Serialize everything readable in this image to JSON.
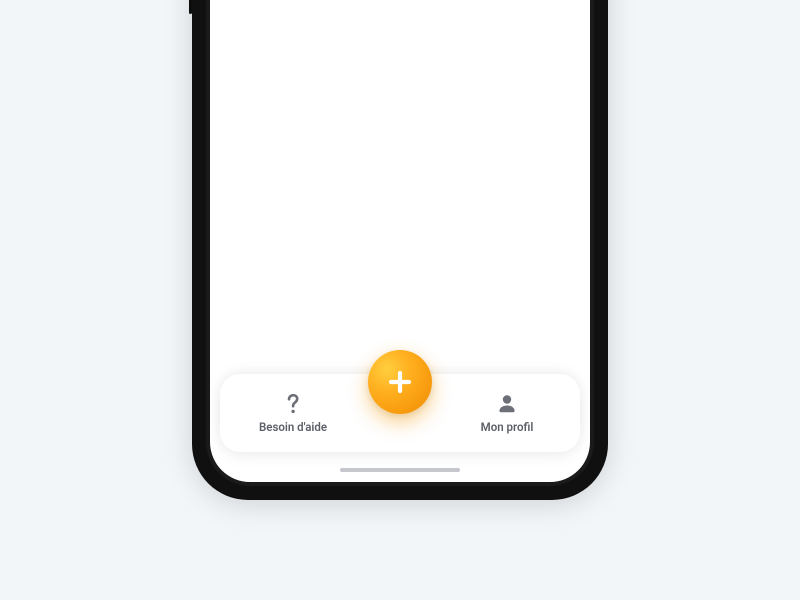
{
  "tabbar": {
    "help": {
      "label": "Besoin d'aide",
      "icon": "question-icon"
    },
    "add": {
      "icon": "plus-icon"
    },
    "profile": {
      "label": "Mon profil",
      "icon": "user-icon"
    }
  },
  "colors": {
    "fab_gradient_start": "#ffcf3f",
    "fab_gradient_mid": "#ffb020",
    "fab_gradient_end": "#f28a00",
    "icon_gray": "#6d6f78",
    "background": "#f3f6f9"
  }
}
